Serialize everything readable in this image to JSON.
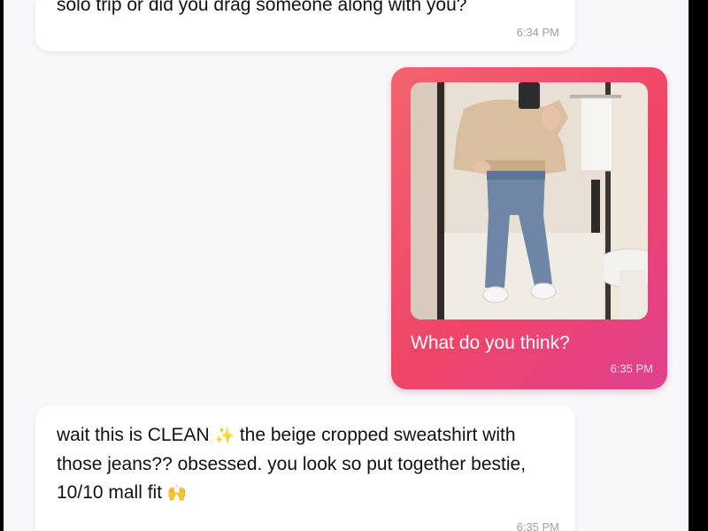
{
  "messages": [
    {
      "direction": "incoming",
      "text": "solo trip or did you drag someone along with you?",
      "time": "6:34 PM"
    },
    {
      "direction": "outgoing",
      "image": "mirror selfie photo",
      "caption": "What do you think?",
      "time": "6:35 PM"
    },
    {
      "direction": "incoming",
      "text_part1": "wait this is CLEAN ",
      "emoji1": "✨",
      "text_part2": " the beige cropped sweatshirt with those jeans?? obsessed. you look so put together bestie, 10/10 mall fit ",
      "emoji2": "🙌",
      "time": "6:35 PM"
    }
  ],
  "colors": {
    "background": "#f8f8fa",
    "incoming_bubble": "#ffffff",
    "outgoing_gradient_start": "#f2646f",
    "outgoing_gradient_end": "#e14190"
  }
}
